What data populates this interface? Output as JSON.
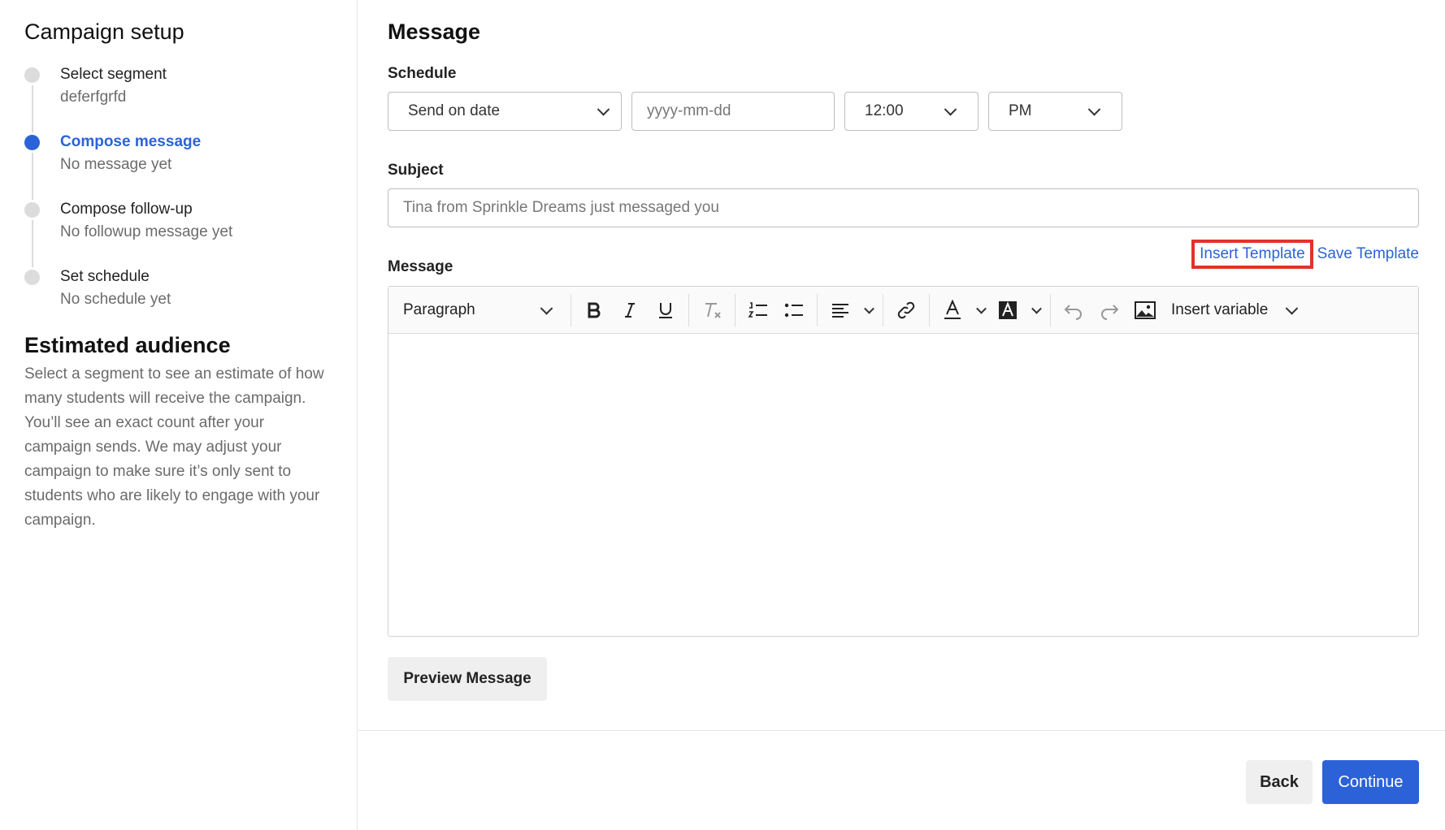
{
  "sidebar": {
    "title": "Campaign setup",
    "steps": [
      {
        "label": "Select segment",
        "sub": "deferfgrfd"
      },
      {
        "label": "Compose message",
        "sub": "No message yet"
      },
      {
        "label": "Compose follow-up",
        "sub": "No followup message yet"
      },
      {
        "label": "Set schedule",
        "sub": "No schedule yet"
      }
    ],
    "audience_title": "Estimated audience",
    "audience_text": "Select a segment to see an estimate of how many students will receive the campaign. You’ll see an exact count after your campaign sends. We may adjust your campaign to make sure it’s only sent to students who are likely to engage with your campaign."
  },
  "main": {
    "title": "Message",
    "schedule": {
      "label": "Schedule",
      "send_option": "Send on date",
      "date_placeholder": "yyyy-mm-dd",
      "time": "12:00",
      "ampm": "PM"
    },
    "subject": {
      "label": "Subject",
      "placeholder": "Tina from Sprinkle Dreams just messaged you"
    },
    "message": {
      "label": "Message",
      "insert_template": "Insert Template",
      "save_template": "Save Template",
      "toolbar": {
        "paragraph": "Paragraph",
        "insert_variable": "Insert variable"
      }
    },
    "preview_label": "Preview Message",
    "back_label": "Back",
    "continue_label": "Continue"
  },
  "colors": {
    "accent": "#2c62d8",
    "highlight": "#e3312c"
  }
}
